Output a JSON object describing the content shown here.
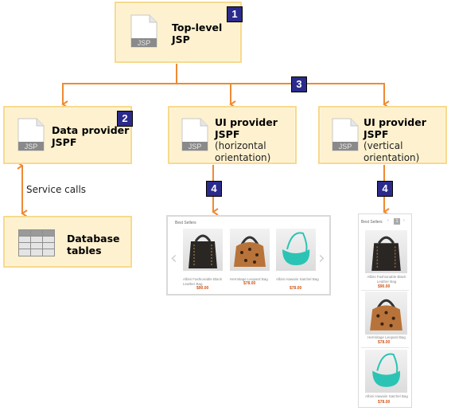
{
  "nodes": {
    "top": {
      "title": "Top-level",
      "title2": "JSP",
      "badge": "1",
      "icon": "jsp-file-icon",
      "icon_label": "JSP"
    },
    "data_provider": {
      "title": "Data provider",
      "title2": "JSPF",
      "badge": "2",
      "icon": "jsp-file-icon",
      "icon_label": "JSP"
    },
    "ui_horizontal": {
      "title": "UI provider JSPF",
      "sub1": "(horizontal",
      "sub2": "orientation)",
      "icon": "jsp-file-icon",
      "icon_label": "JSP"
    },
    "ui_vertical": {
      "title": "UI provider JSPF",
      "sub1": "(vertical",
      "sub2": "orientation)",
      "icon": "jsp-file-icon",
      "icon_label": "JSP"
    },
    "database": {
      "title": "Database",
      "title2": "tables",
      "icon": "database-table-icon"
    }
  },
  "badges": {
    "three": "3",
    "four_h": "4",
    "four_v": "4"
  },
  "edges": {
    "service_calls": "Service calls"
  },
  "horizontal_widget": {
    "title": "Best Sellers",
    "products": [
      {
        "name": "Albini Fashionable Black Leather Bag",
        "price": "$90.00",
        "color": "#2a2624"
      },
      {
        "name": "Hermitage Leopard Bag",
        "price": "$78.00",
        "color": "#b8733a"
      },
      {
        "name": "Albini Hawaiin Satchel Bag",
        "price": "$78.00",
        "color": "#2bc4b4"
      }
    ]
  },
  "vertical_widget": {
    "title": "Best Sellers",
    "page": "1",
    "products": [
      {
        "name": "Albini Fashionable Black Leather Bag",
        "price": "$90.00",
        "color": "#2a2624"
      },
      {
        "name": "Hermitage Leopard Bag",
        "price": "$78.00",
        "color": "#b8733a"
      },
      {
        "name": "Albini Hawaiin Satchel Bag",
        "price": "$78.00",
        "color": "#2bc4b4"
      }
    ]
  },
  "colors": {
    "accent": "#ee8a34",
    "badge": "#2b2b8c",
    "box_fill": "#fdf1cf",
    "box_border": "#f8d98c",
    "price": "#d2571a"
  }
}
